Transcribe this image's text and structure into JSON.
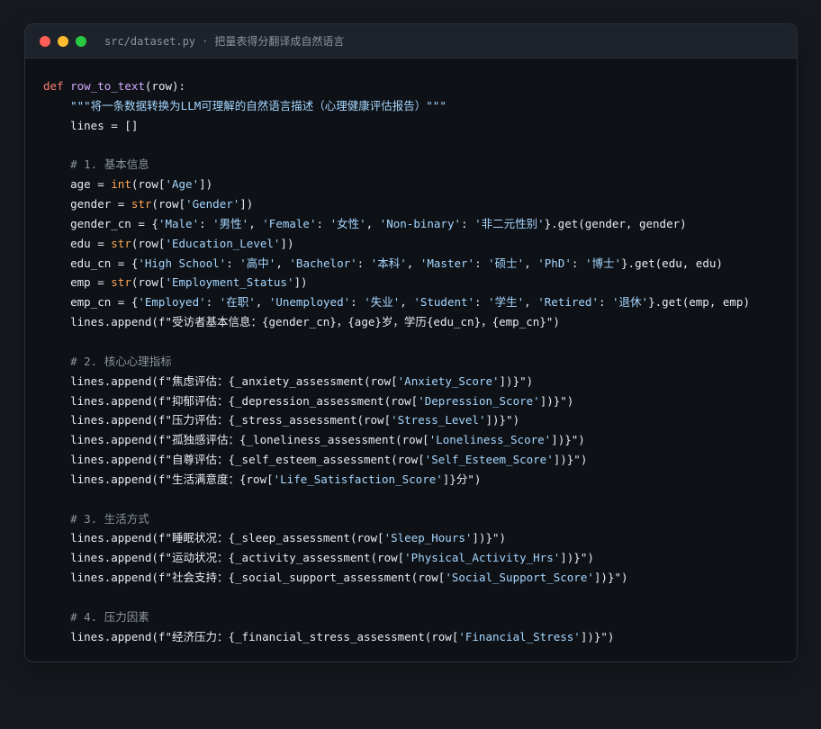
{
  "window": {
    "file_path": "src/dataset.py",
    "separator": "·",
    "subtitle": "把量表得分翻译成自然语言",
    "colors": {
      "close": "#ff5f57",
      "minimize": "#febc2e",
      "maximize": "#28c840",
      "background": "#0e1116",
      "keyword": "#ff7b72",
      "function": "#d2a8ff",
      "string": "#a5d6ff",
      "comment": "#8b949e",
      "builtin": "#ffa657"
    }
  },
  "code": {
    "lines": [
      [
        {
          "t": "kw",
          "v": "def "
        },
        {
          "t": "fn",
          "v": "row_to_text"
        },
        {
          "t": "",
          "v": "(row):"
        }
      ],
      [
        {
          "t": "",
          "v": "    "
        },
        {
          "t": "str",
          "v": "\"\"\"将一条数据转换为LLM可理解的自然语言描述（心理健康评估报告）\"\"\""
        }
      ],
      [
        {
          "t": "",
          "v": "    lines = []"
        }
      ],
      [],
      [
        {
          "t": "",
          "v": "    "
        },
        {
          "t": "cm",
          "v": "# 1. 基本信息"
        }
      ],
      [
        {
          "t": "",
          "v": "    age = "
        },
        {
          "t": "bi",
          "v": "int"
        },
        {
          "t": "",
          "v": "(row["
        },
        {
          "t": "str",
          "v": "'Age'"
        },
        {
          "t": "",
          "v": "])"
        }
      ],
      [
        {
          "t": "",
          "v": "    gender = "
        },
        {
          "t": "bi",
          "v": "str"
        },
        {
          "t": "",
          "v": "(row["
        },
        {
          "t": "str",
          "v": "'Gender'"
        },
        {
          "t": "",
          "v": "])"
        }
      ],
      [
        {
          "t": "",
          "v": "    gender_cn = {"
        },
        {
          "t": "str",
          "v": "'Male'"
        },
        {
          "t": "",
          "v": ": "
        },
        {
          "t": "str",
          "v": "'男性'"
        },
        {
          "t": "",
          "v": ", "
        },
        {
          "t": "str",
          "v": "'Female'"
        },
        {
          "t": "",
          "v": ": "
        },
        {
          "t": "str",
          "v": "'女性'"
        },
        {
          "t": "",
          "v": ", "
        },
        {
          "t": "str",
          "v": "'Non-binary'"
        },
        {
          "t": "",
          "v": ": "
        },
        {
          "t": "str",
          "v": "'非二元性别'"
        },
        {
          "t": "",
          "v": "}.get(gender, gender)"
        }
      ],
      [
        {
          "t": "",
          "v": "    edu = "
        },
        {
          "t": "bi",
          "v": "str"
        },
        {
          "t": "",
          "v": "(row["
        },
        {
          "t": "str",
          "v": "'Education_Level'"
        },
        {
          "t": "",
          "v": "])"
        }
      ],
      [
        {
          "t": "",
          "v": "    edu_cn = {"
        },
        {
          "t": "str",
          "v": "'High School'"
        },
        {
          "t": "",
          "v": ": "
        },
        {
          "t": "str",
          "v": "'高中'"
        },
        {
          "t": "",
          "v": ", "
        },
        {
          "t": "str",
          "v": "'Bachelor'"
        },
        {
          "t": "",
          "v": ": "
        },
        {
          "t": "str",
          "v": "'本科'"
        },
        {
          "t": "",
          "v": ", "
        },
        {
          "t": "str",
          "v": "'Master'"
        },
        {
          "t": "",
          "v": ": "
        },
        {
          "t": "str",
          "v": "'硕士'"
        },
        {
          "t": "",
          "v": ", "
        },
        {
          "t": "str",
          "v": "'PhD'"
        },
        {
          "t": "",
          "v": ": "
        },
        {
          "t": "str",
          "v": "'博士'"
        },
        {
          "t": "",
          "v": "}.get(edu, edu)"
        }
      ],
      [
        {
          "t": "",
          "v": "    emp = "
        },
        {
          "t": "bi",
          "v": "str"
        },
        {
          "t": "",
          "v": "(row["
        },
        {
          "t": "str",
          "v": "'Employment_Status'"
        },
        {
          "t": "",
          "v": "])"
        }
      ],
      [
        {
          "t": "",
          "v": "    emp_cn = {"
        },
        {
          "t": "str",
          "v": "'Employed'"
        },
        {
          "t": "",
          "v": ": "
        },
        {
          "t": "str",
          "v": "'在职'"
        },
        {
          "t": "",
          "v": ", "
        },
        {
          "t": "str",
          "v": "'Unemployed'"
        },
        {
          "t": "",
          "v": ": "
        },
        {
          "t": "str",
          "v": "'失业'"
        },
        {
          "t": "",
          "v": ", "
        },
        {
          "t": "str",
          "v": "'Student'"
        },
        {
          "t": "",
          "v": ": "
        },
        {
          "t": "str",
          "v": "'学生'"
        },
        {
          "t": "",
          "v": ", "
        },
        {
          "t": "str",
          "v": "'Retired'"
        },
        {
          "t": "",
          "v": ": "
        },
        {
          "t": "str",
          "v": "'退休'"
        },
        {
          "t": "",
          "v": "}.get(emp, emp)"
        }
      ],
      [
        {
          "t": "",
          "v": "    lines.append(f\"受访者基本信息：{gender_cn}，{age}岁，学历{edu_cn}，{emp_cn}\")"
        }
      ],
      [],
      [
        {
          "t": "",
          "v": "    "
        },
        {
          "t": "cm",
          "v": "# 2. 核心心理指标"
        }
      ],
      [
        {
          "t": "",
          "v": "    lines.append(f\"焦虑评估：{_anxiety_assessment(row["
        },
        {
          "t": "str",
          "v": "'Anxiety_Score'"
        },
        {
          "t": "",
          "v": "])}\")"
        }
      ],
      [
        {
          "t": "",
          "v": "    lines.append(f\"抑郁评估：{_depression_assessment(row["
        },
        {
          "t": "str",
          "v": "'Depression_Score'"
        },
        {
          "t": "",
          "v": "])}\")"
        }
      ],
      [
        {
          "t": "",
          "v": "    lines.append(f\"压力评估：{_stress_assessment(row["
        },
        {
          "t": "str",
          "v": "'Stress_Level'"
        },
        {
          "t": "",
          "v": "])}\")"
        }
      ],
      [
        {
          "t": "",
          "v": "    lines.append(f\"孤独感评估：{_loneliness_assessment(row["
        },
        {
          "t": "str",
          "v": "'Loneliness_Score'"
        },
        {
          "t": "",
          "v": "])}\")"
        }
      ],
      [
        {
          "t": "",
          "v": "    lines.append(f\"自尊评估：{_self_esteem_assessment(row["
        },
        {
          "t": "str",
          "v": "'Self_Esteem_Score'"
        },
        {
          "t": "",
          "v": "])}\")"
        }
      ],
      [
        {
          "t": "",
          "v": "    lines.append(f\"生活满意度：{row["
        },
        {
          "t": "str",
          "v": "'Life_Satisfaction_Score'"
        },
        {
          "t": "",
          "v": "]}分\")"
        }
      ],
      [],
      [
        {
          "t": "",
          "v": "    "
        },
        {
          "t": "cm",
          "v": "# 3. 生活方式"
        }
      ],
      [
        {
          "t": "",
          "v": "    lines.append(f\"睡眠状况：{_sleep_assessment(row["
        },
        {
          "t": "str",
          "v": "'Sleep_Hours'"
        },
        {
          "t": "",
          "v": "])}\")"
        }
      ],
      [
        {
          "t": "",
          "v": "    lines.append(f\"运动状况：{_activity_assessment(row["
        },
        {
          "t": "str",
          "v": "'Physical_Activity_Hrs'"
        },
        {
          "t": "",
          "v": "])}\")"
        }
      ],
      [
        {
          "t": "",
          "v": "    lines.append(f\"社会支持：{_social_support_assessment(row["
        },
        {
          "t": "str",
          "v": "'Social_Support_Score'"
        },
        {
          "t": "",
          "v": "])}\")"
        }
      ],
      [],
      [
        {
          "t": "",
          "v": "    "
        },
        {
          "t": "cm",
          "v": "# 4. 压力因素"
        }
      ],
      [
        {
          "t": "",
          "v": "    lines.append(f\"经济压力：{_financial_stress_assessment(row["
        },
        {
          "t": "str",
          "v": "'Financial_Stress'"
        },
        {
          "t": "",
          "v": "])}\")"
        }
      ]
    ]
  }
}
